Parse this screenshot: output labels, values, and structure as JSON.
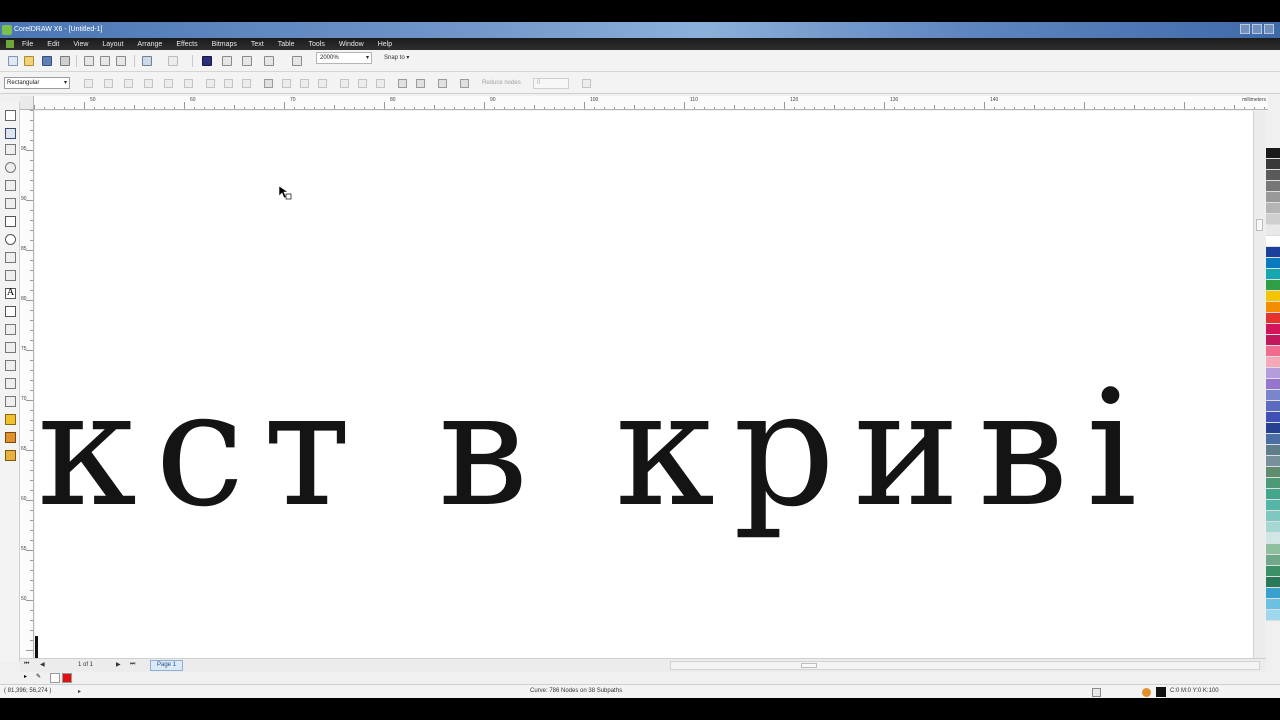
{
  "window": {
    "title": "CorelDRAW X6 - [Untitled-1]"
  },
  "menu": [
    "File",
    "Edit",
    "View",
    "Layout",
    "Arrange",
    "Effects",
    "Bitmaps",
    "Text",
    "Table",
    "Tools",
    "Window",
    "Help"
  ],
  "toolbar": {
    "zoom_value": "2000%",
    "snap_label": "Snap to"
  },
  "propbar": {
    "shape_preset": "Rectangular",
    "reduce_nodes_label": "Reduce nodes",
    "reduce_nodes_value": "0"
  },
  "ruler": {
    "units": "millimeters",
    "h_labels": [
      "50",
      "60",
      "70",
      "80",
      "90",
      "100",
      "110",
      "120",
      "130",
      "140"
    ],
    "v_labels": [
      "95",
      "90",
      "85",
      "80",
      "75",
      "70",
      "65",
      "60",
      "55",
      "50"
    ]
  },
  "canvas": {
    "text": "кст в криві"
  },
  "pagenav": {
    "pager": "1 of 1",
    "page_tab": "Page 1"
  },
  "status": {
    "coords": "( 81,396; 56,274 )",
    "info": "Curve: 786 Nodes on 38 Subpaths",
    "color_info": "C:0 M:0 Y:0 K:100"
  },
  "palette": [
    "#1a1a1a",
    "#3a3a3a",
    "#5a5a5a",
    "#777777",
    "#999999",
    "#b5b5b5",
    "#cfcfcf",
    "#e8e8e8",
    "#ffffff",
    "#1b3f9a",
    "#0a7abf",
    "#16a6b0",
    "#2f9e44",
    "#f2c500",
    "#f28c00",
    "#e5322d",
    "#d4145a",
    "#c2185b",
    "#ef6c8f",
    "#f7a8b8",
    "#b39ddb",
    "#9575cd",
    "#7986cb",
    "#5c6bc0",
    "#3f51b5",
    "#26418f",
    "#4a6fa5",
    "#607d8b",
    "#78909c",
    "#5f8c6e",
    "#4e9a78",
    "#43a58c",
    "#55b5a6",
    "#7fc8c0",
    "#a5d8d2",
    "#cfe8e5",
    "#8fbf9f",
    "#6fa88b",
    "#3d8f6a",
    "#2b7a57",
    "#3aa0d0",
    "#6cc0e0",
    "#9ed8ee"
  ],
  "doc_colors": [
    "#ffffff",
    "#e01010"
  ]
}
